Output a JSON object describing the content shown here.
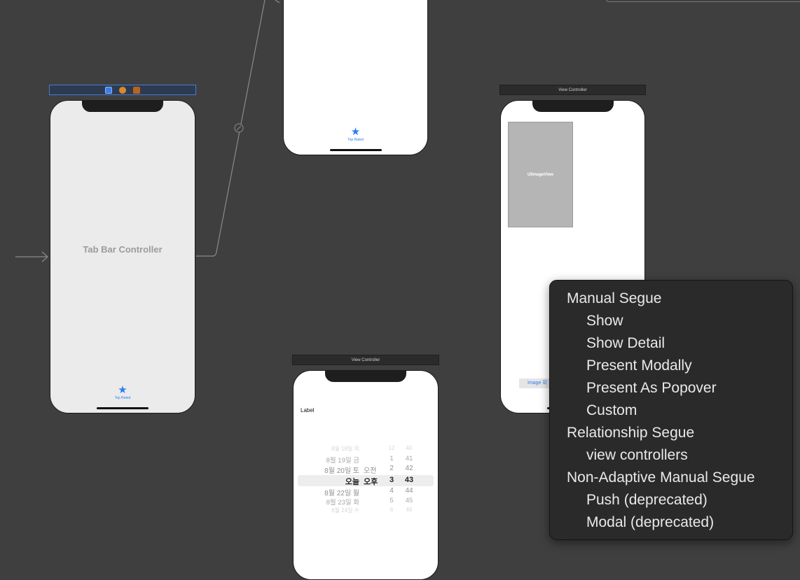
{
  "tab_bar_controller": {
    "title": "Tab Bar Controller",
    "tab_item_label": "Top Rated"
  },
  "top_rated_scene": {
    "tab_item_label": "Top Rated"
  },
  "view_controller_right": {
    "bar_title": "View Controller",
    "imageview_label": "UIImageView",
    "button_label": "Image 확"
  },
  "view_controller_bottom": {
    "bar_title": "View Controller",
    "label_text": "Label",
    "picker": {
      "rows": [
        {
          "date": "8월 18일 목",
          "ampm": "",
          "hour": "12",
          "minute": "40"
        },
        {
          "date": "8월 19일 금",
          "ampm": "",
          "hour": "1",
          "minute": "41"
        },
        {
          "date": "8월 20일 토",
          "ampm": "오전",
          "hour": "2",
          "minute": "42"
        },
        {
          "date": "오늘",
          "ampm": "오후",
          "hour": "3",
          "minute": "43"
        },
        {
          "date": "8월 22일 월",
          "ampm": "",
          "hour": "4",
          "minute": "44"
        },
        {
          "date": "8월 23일 화",
          "ampm": "",
          "hour": "5",
          "minute": "45"
        },
        {
          "date": "8월 24일 수",
          "ampm": "",
          "hour": "6",
          "minute": "46"
        }
      ]
    }
  },
  "segue_menu": {
    "items": [
      {
        "label": "Manual Segue",
        "indent": false
      },
      {
        "label": "Show",
        "indent": true
      },
      {
        "label": "Show Detail",
        "indent": true
      },
      {
        "label": "Present Modally",
        "indent": true
      },
      {
        "label": "Present As Popover",
        "indent": true
      },
      {
        "label": "Custom",
        "indent": true
      },
      {
        "label": "Relationship Segue",
        "indent": false
      },
      {
        "label": "view controllers",
        "indent": true
      },
      {
        "label": "Non-Adaptive Manual Segue",
        "indent": false
      },
      {
        "label": "Push (deprecated)",
        "indent": true
      },
      {
        "label": "Modal (deprecated)",
        "indent": true
      }
    ]
  },
  "colors": {
    "canvas": "#3f3f3f",
    "accent_blue": "#2e7cf6",
    "menu_bg": "#2a2a2a",
    "menu_text": "#e9e9e9"
  }
}
